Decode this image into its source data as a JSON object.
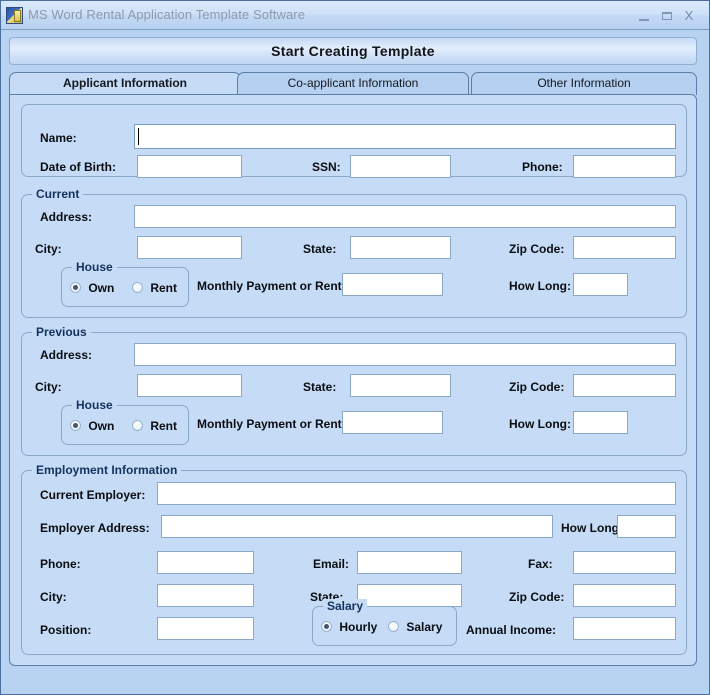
{
  "window": {
    "title": "MS Word Rental Application Template Software",
    "icon": "app-document-icon",
    "minimize_label": "",
    "maximize_label": "",
    "close_label": "X"
  },
  "colors": {
    "window_bg": "#b8d3f2",
    "panel_bg": "#c6dcf6",
    "border": "#5b7fa8",
    "group_label": "#14325e",
    "field_bg": "#ffffff",
    "titlebar_text": "#8d9aa8"
  },
  "toolbar": {
    "start_button_label": "Start Creating Template"
  },
  "tabs": [
    {
      "label": "Applicant Information",
      "active": true
    },
    {
      "label": "Co-applicant Information",
      "active": false
    },
    {
      "label": "Other Information",
      "active": false
    }
  ],
  "applicant": {
    "personal": {
      "group_label": "",
      "name_label": "Name:",
      "name_value": "",
      "name_placeholder": "",
      "dob_label": "Date of Birth:",
      "dob_value": "",
      "ssn_label": "SSN:",
      "ssn_value": "",
      "phone_label": "Phone:",
      "phone_value": ""
    },
    "current": {
      "group_label": "Current",
      "address_label": "Address:",
      "address_value": "",
      "city_label": "City:",
      "city_value": "",
      "state_label": "State:",
      "state_value": "",
      "zip_label": "Zip Code:",
      "zip_value": "",
      "house": {
        "group_label": "House",
        "options": [
          {
            "label": "Own",
            "selected": true
          },
          {
            "label": "Rent",
            "selected": false
          }
        ]
      },
      "payment_label": "Monthly Payment or Rent:",
      "payment_value": "",
      "howlong_label": "How Long:",
      "howlong_value": ""
    },
    "previous": {
      "group_label": "Previous",
      "address_label": "Address:",
      "address_value": "",
      "city_label": "City:",
      "city_value": "",
      "state_label": "State:",
      "state_value": "",
      "zip_label": "Zip Code:",
      "zip_value": "",
      "house": {
        "group_label": "House",
        "options": [
          {
            "label": "Own",
            "selected": true
          },
          {
            "label": "Rent",
            "selected": false
          }
        ]
      },
      "payment_label": "Monthly Payment or Rent:",
      "payment_value": "",
      "howlong_label": "How Long:",
      "howlong_value": ""
    },
    "employment": {
      "group_label": "Employment Information",
      "employer_label": "Current Employer:",
      "employer_value": "",
      "employer_address_label": "Employer Address:",
      "employer_address_value": "",
      "howlong_label": "How Long:",
      "howlong_value": "",
      "phone_label": "Phone:",
      "phone_value": "",
      "email_label": "Email:",
      "email_value": "",
      "fax_label": "Fax:",
      "fax_value": "",
      "city_label": "City:",
      "city_value": "",
      "state_label": "State:",
      "state_value": "",
      "zip_label": "Zip Code:",
      "zip_value": "",
      "position_label": "Position:",
      "position_value": "",
      "salary": {
        "group_label": "Salary",
        "options": [
          {
            "label": "Hourly",
            "selected": true
          },
          {
            "label": "Salary",
            "selected": false
          }
        ]
      },
      "annual_income_label": "Annual Income:",
      "annual_income_value": ""
    }
  }
}
